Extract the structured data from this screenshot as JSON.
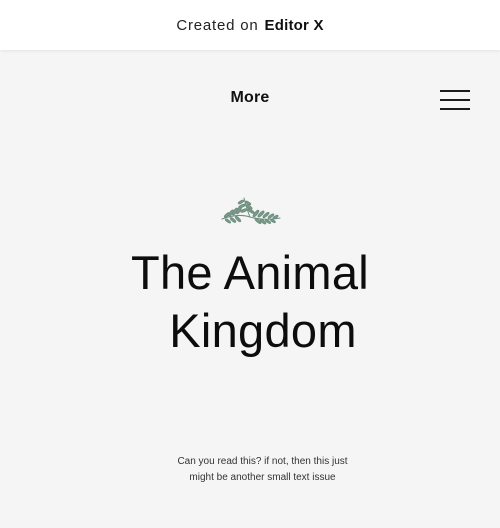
{
  "promo_banner": {
    "text": "Created on",
    "brand": "Editor X"
  },
  "header": {
    "nav_label": "More",
    "menu_icon": "hamburger-menu-icon"
  },
  "hero": {
    "decoration_icon": "fern-leaf-icon",
    "accent_color": "#6e8f80",
    "title_line1": "The Animal",
    "title_line2": "Kingdom",
    "caption_line1": "Can you read this? if not, then this just",
    "caption_line2": "might be another small text issue"
  }
}
